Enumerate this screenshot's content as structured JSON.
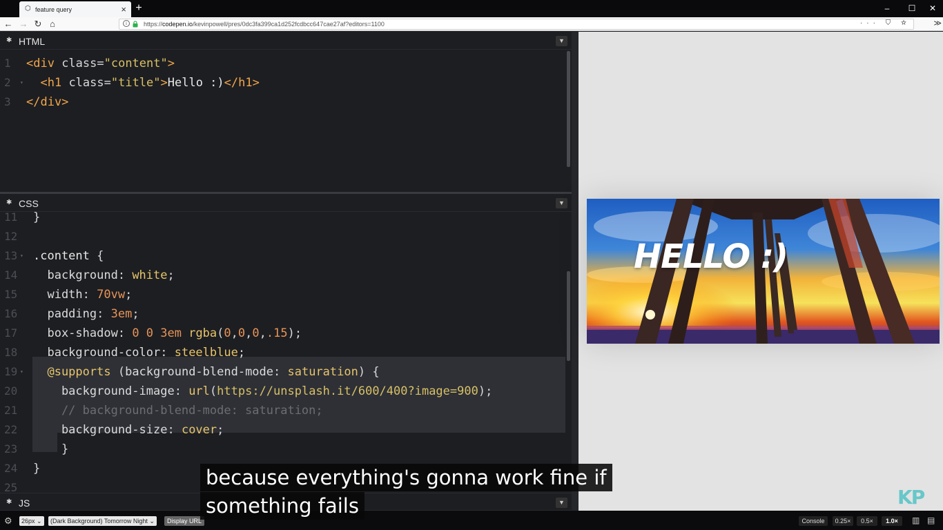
{
  "browser": {
    "tab_title": "feature query",
    "tab_favicon": "codepen-icon",
    "url": "https://codepen.io/kevinpowell/pres/0dc3fa399ca1d252fcdbcc647cae27af?editors=1100",
    "url_prefix": "https://",
    "url_host": "codepen.io",
    "url_path": "/kevinpowell/pres/0dc3fa399ca1d252fcdbcc647cae27af?editors=1100",
    "url_actions": "···  ⛉  ☆",
    "extensions": "≫"
  },
  "panes": {
    "html": {
      "title": "HTML"
    },
    "css": {
      "title": "CSS"
    },
    "js": {
      "title": "JS"
    }
  },
  "html_code": [
    {
      "n": "1",
      "fold": "",
      "tokens": [
        [
          "t-tag",
          "<div "
        ],
        [
          "t-attr",
          "class="
        ],
        [
          "t-str",
          "\"content\""
        ],
        [
          "t-tag",
          ">"
        ]
      ]
    },
    {
      "n": "2",
      "fold": "▾",
      "tokens": [
        [
          "t-txt",
          "  "
        ],
        [
          "t-tag",
          "<h1 "
        ],
        [
          "t-attr",
          "class="
        ],
        [
          "t-str",
          "\"title\""
        ],
        [
          "t-tag",
          ">"
        ],
        [
          "t-txt",
          "Hello :)"
        ],
        [
          "t-tag",
          "</h1>"
        ]
      ]
    },
    {
      "n": "3",
      "fold": "",
      "tokens": [
        [
          "t-tag",
          "</div>"
        ]
      ]
    }
  ],
  "css_code": [
    {
      "n": "11",
      "fold": "",
      "tokens": [
        [
          "t-pun",
          "}"
        ]
      ]
    },
    {
      "n": "12",
      "fold": "",
      "tokens": []
    },
    {
      "n": "13",
      "fold": "▾",
      "tokens": [
        [
          "t-sel",
          ".content "
        ],
        [
          "t-pun",
          "{"
        ]
      ]
    },
    {
      "n": "14",
      "fold": "",
      "tokens": [
        [
          "t-prop",
          "  background"
        ],
        [
          "t-pun",
          ": "
        ],
        [
          "t-val",
          "white"
        ],
        [
          "t-pun",
          ";"
        ]
      ]
    },
    {
      "n": "15",
      "fold": "",
      "tokens": [
        [
          "t-prop",
          "  width"
        ],
        [
          "t-pun",
          ": "
        ],
        [
          "t-num",
          "70vw"
        ],
        [
          "t-pun",
          ";"
        ]
      ]
    },
    {
      "n": "16",
      "fold": "",
      "tokens": [
        [
          "t-prop",
          "  padding"
        ],
        [
          "t-pun",
          ": "
        ],
        [
          "t-num",
          "3em"
        ],
        [
          "t-pun",
          ";"
        ]
      ]
    },
    {
      "n": "17",
      "fold": "",
      "tokens": [
        [
          "t-prop",
          "  box-shadow"
        ],
        [
          "t-pun",
          ": "
        ],
        [
          "t-num",
          "0 0 3em "
        ],
        [
          "t-val",
          "rgba"
        ],
        [
          "t-pun",
          "("
        ],
        [
          "t-num",
          "0"
        ],
        [
          "t-pun",
          ","
        ],
        [
          "t-num",
          "0"
        ],
        [
          "t-pun",
          ","
        ],
        [
          "t-num",
          "0"
        ],
        [
          "t-pun",
          ","
        ],
        [
          "t-num",
          ".15"
        ],
        [
          "t-pun",
          ");"
        ]
      ]
    },
    {
      "n": "18",
      "fold": "",
      "tokens": [
        [
          "t-prop",
          "  background-color"
        ],
        [
          "t-pun",
          ": "
        ],
        [
          "t-val",
          "steelblue"
        ],
        [
          "t-pun",
          ";"
        ]
      ]
    },
    {
      "n": "19",
      "fold": "▾",
      "tokens": [
        [
          "t-at",
          "  @supports "
        ],
        [
          "t-pun",
          "("
        ],
        [
          "t-prop",
          "background-blend-mode"
        ],
        [
          "t-pun",
          ": "
        ],
        [
          "t-val",
          "saturation"
        ],
        [
          "t-pun",
          ") {"
        ]
      ]
    },
    {
      "n": "20",
      "fold": "",
      "tokens": [
        [
          "t-prop",
          "    background-image"
        ],
        [
          "t-pun",
          ": "
        ],
        [
          "t-val",
          "url"
        ],
        [
          "t-pun",
          "("
        ],
        [
          "t-str",
          "https://unsplash.it/600/400?image=900"
        ],
        [
          "t-pun",
          ");"
        ]
      ]
    },
    {
      "n": "21",
      "fold": "",
      "tokens": [
        [
          "t-com",
          "    // background-blend-mode: saturation;"
        ]
      ]
    },
    {
      "n": "22",
      "fold": "",
      "tokens": [
        [
          "t-prop",
          "    background-size"
        ],
        [
          "t-pun",
          ": "
        ],
        [
          "t-val",
          "cover"
        ],
        [
          "t-pun",
          ";"
        ]
      ]
    },
    {
      "n": "23",
      "fold": "",
      "tokens": [
        [
          "t-pun",
          "    }"
        ]
      ]
    },
    {
      "n": "24",
      "fold": "",
      "tokens": [
        [
          "t-pun",
          "}"
        ]
      ]
    },
    {
      "n": "25",
      "fold": "",
      "tokens": []
    }
  ],
  "preview": {
    "heading": "HELLO :)",
    "logo": "KP"
  },
  "bottombar": {
    "font_size": "26px",
    "theme": "(Dark Background) Tomorrow Night",
    "display_url": "Display URL",
    "console": "Console",
    "zoom_options": [
      "0.25×",
      "0.5×",
      "1.0×"
    ]
  },
  "caption": {
    "line1": "because everything's gonna work fine if",
    "line2": "something fails"
  }
}
